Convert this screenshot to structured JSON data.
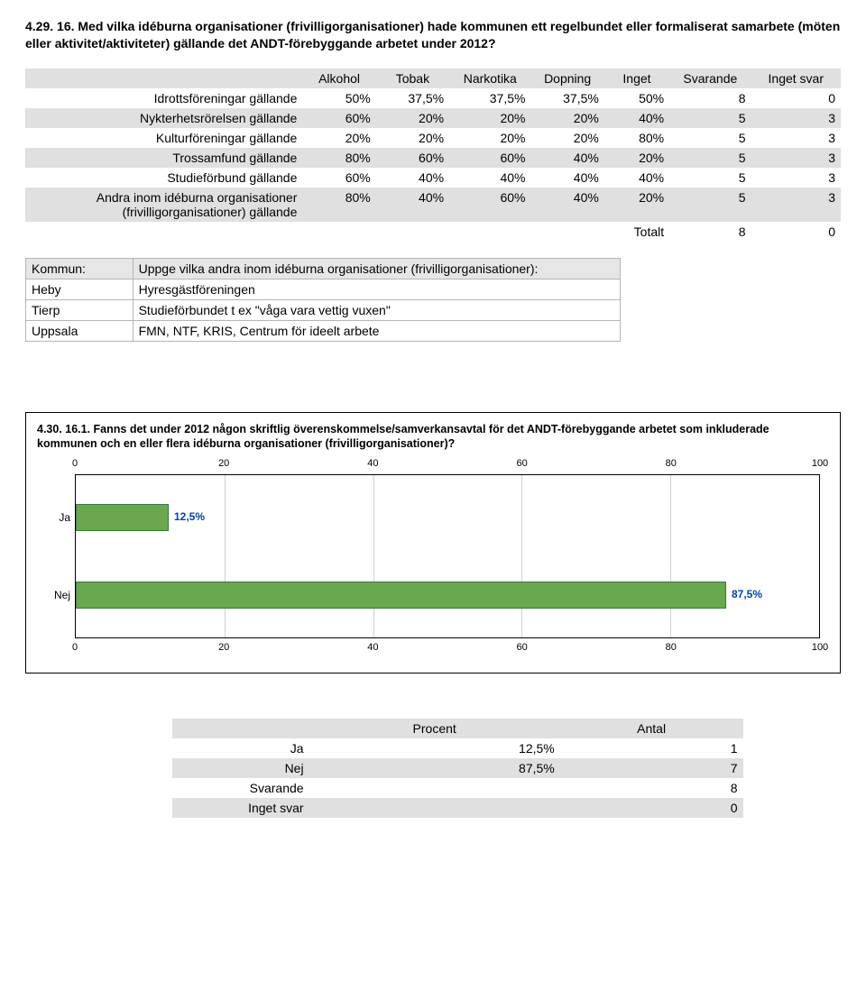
{
  "question1": {
    "title": "4.29. 16. Med vilka idéburna organisationer (frivilligorganisationer) hade kommunen ett regelbundet eller formaliserat samarbete (möten eller aktivitet/aktiviteter) gällande det ANDT-förebyggande arbetet under 2012?",
    "columns": [
      "Alkohol",
      "Tobak",
      "Narkotika",
      "Dopning",
      "Inget",
      "Svarande",
      "Inget svar"
    ],
    "rows": [
      {
        "label": "Idrottsföreningar gällande",
        "vals": [
          "50%",
          "37,5%",
          "37,5%",
          "37,5%",
          "50%",
          "8",
          "0"
        ]
      },
      {
        "label": "Nykterhetsrörelsen gällande",
        "vals": [
          "60%",
          "20%",
          "20%",
          "20%",
          "40%",
          "5",
          "3"
        ]
      },
      {
        "label": "Kulturföreningar gällande",
        "vals": [
          "20%",
          "20%",
          "20%",
          "20%",
          "80%",
          "5",
          "3"
        ]
      },
      {
        "label": "Trossamfund gällande",
        "vals": [
          "80%",
          "60%",
          "60%",
          "40%",
          "20%",
          "5",
          "3"
        ]
      },
      {
        "label": "Studieförbund gällande",
        "vals": [
          "60%",
          "40%",
          "40%",
          "40%",
          "40%",
          "5",
          "3"
        ]
      },
      {
        "label": "Andra inom idéburna organisationer (frivilligorganisationer) gällande",
        "vals": [
          "80%",
          "40%",
          "60%",
          "40%",
          "20%",
          "5",
          "3"
        ]
      }
    ],
    "totalLabel": "Totalt",
    "totalVals": [
      "8",
      "0"
    ]
  },
  "freetext": {
    "headerKommun": "Kommun:",
    "headerPrompt": "Uppge vilka andra inom idéburna organisationer (frivilligorganisationer):",
    "rows": [
      {
        "k": "Heby",
        "v": "Hyresgästföreningen"
      },
      {
        "k": "Tierp",
        "v": "Studieförbundet t ex \"våga vara vettig vuxen\""
      },
      {
        "k": "Uppsala",
        "v": "FMN, NTF, KRIS, Centrum för ideelt arbete"
      }
    ]
  },
  "question2": {
    "title": "4.30. 16.1. Fanns det under 2012 någon skriftlig överenskommelse/samverkansavtal för det ANDT-förebyggande arbetet som inkluderade kommunen och en eller flera idéburna organisationer (frivilligorganisationer)?"
  },
  "chart_data": {
    "type": "bar",
    "orientation": "horizontal",
    "categories": [
      "Ja",
      "Nej"
    ],
    "values": [
      12.5,
      87.5
    ],
    "value_labels": [
      "12,5%",
      "87,5%"
    ],
    "xlim": [
      0,
      100
    ],
    "ticks": [
      0,
      20,
      40,
      60,
      80,
      100
    ]
  },
  "summary": {
    "headerProcent": "Procent",
    "headerAntal": "Antal",
    "rows": [
      {
        "label": "Ja",
        "procent": "12,5%",
        "antal": "1"
      },
      {
        "label": "Nej",
        "procent": "87,5%",
        "antal": "7"
      },
      {
        "label": "Svarande",
        "procent": "",
        "antal": "8"
      },
      {
        "label": "Inget svar",
        "procent": "",
        "antal": "0"
      }
    ]
  }
}
